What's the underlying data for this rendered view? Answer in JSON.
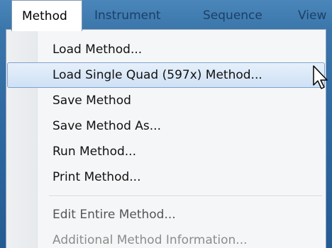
{
  "menubar": {
    "items": [
      {
        "label": "Method",
        "active": true
      },
      {
        "label": "Instrument",
        "active": false
      },
      {
        "label": "Sequence",
        "active": false
      },
      {
        "label": "View",
        "active": false
      }
    ]
  },
  "menu": {
    "items": [
      {
        "label": "Load Method...",
        "enabled": true
      },
      {
        "label": "Load Single Quad (597x) Method...",
        "enabled": true,
        "highlighted": true
      },
      {
        "label": "Save Method",
        "enabled": true
      },
      {
        "label": "Save Method As...",
        "enabled": true
      },
      {
        "label": "Run Method...",
        "enabled": true
      },
      {
        "label": "Print Method...",
        "enabled": true
      },
      {
        "label": "Edit Entire Method...",
        "enabled": true
      },
      {
        "label": "Additional Method Information...",
        "enabled": false
      }
    ]
  },
  "cursor": {
    "icon": "arrow-pointer-icon"
  }
}
